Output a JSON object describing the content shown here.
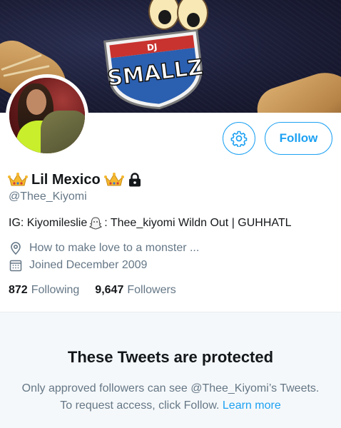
{
  "header": {
    "follow_label": "Follow",
    "settings_icon": "gear-icon"
  },
  "profile": {
    "display_name": "Lil Mexico",
    "handle": "@Thee_Kiyomi",
    "bio_part1": "IG: Kiyomileslie",
    "bio_part2": ": Thee_kiyomi Wildn Out | GUHHATL",
    "location": "How to make love to a monster ...",
    "joined": "Joined December 2009",
    "following_count": "872",
    "following_label": "Following",
    "followers_count": "9,647",
    "followers_label": "Followers"
  },
  "protected": {
    "title": "These Tweets are protected",
    "message": "Only approved followers can see @Thee_Kiyomi’s Tweets. To request access, click Follow.",
    "learn_more": "Learn more"
  },
  "colors": {
    "accent": "#1da1f2",
    "secondary_text": "#657786",
    "panel_bg": "#f5f8fa"
  }
}
